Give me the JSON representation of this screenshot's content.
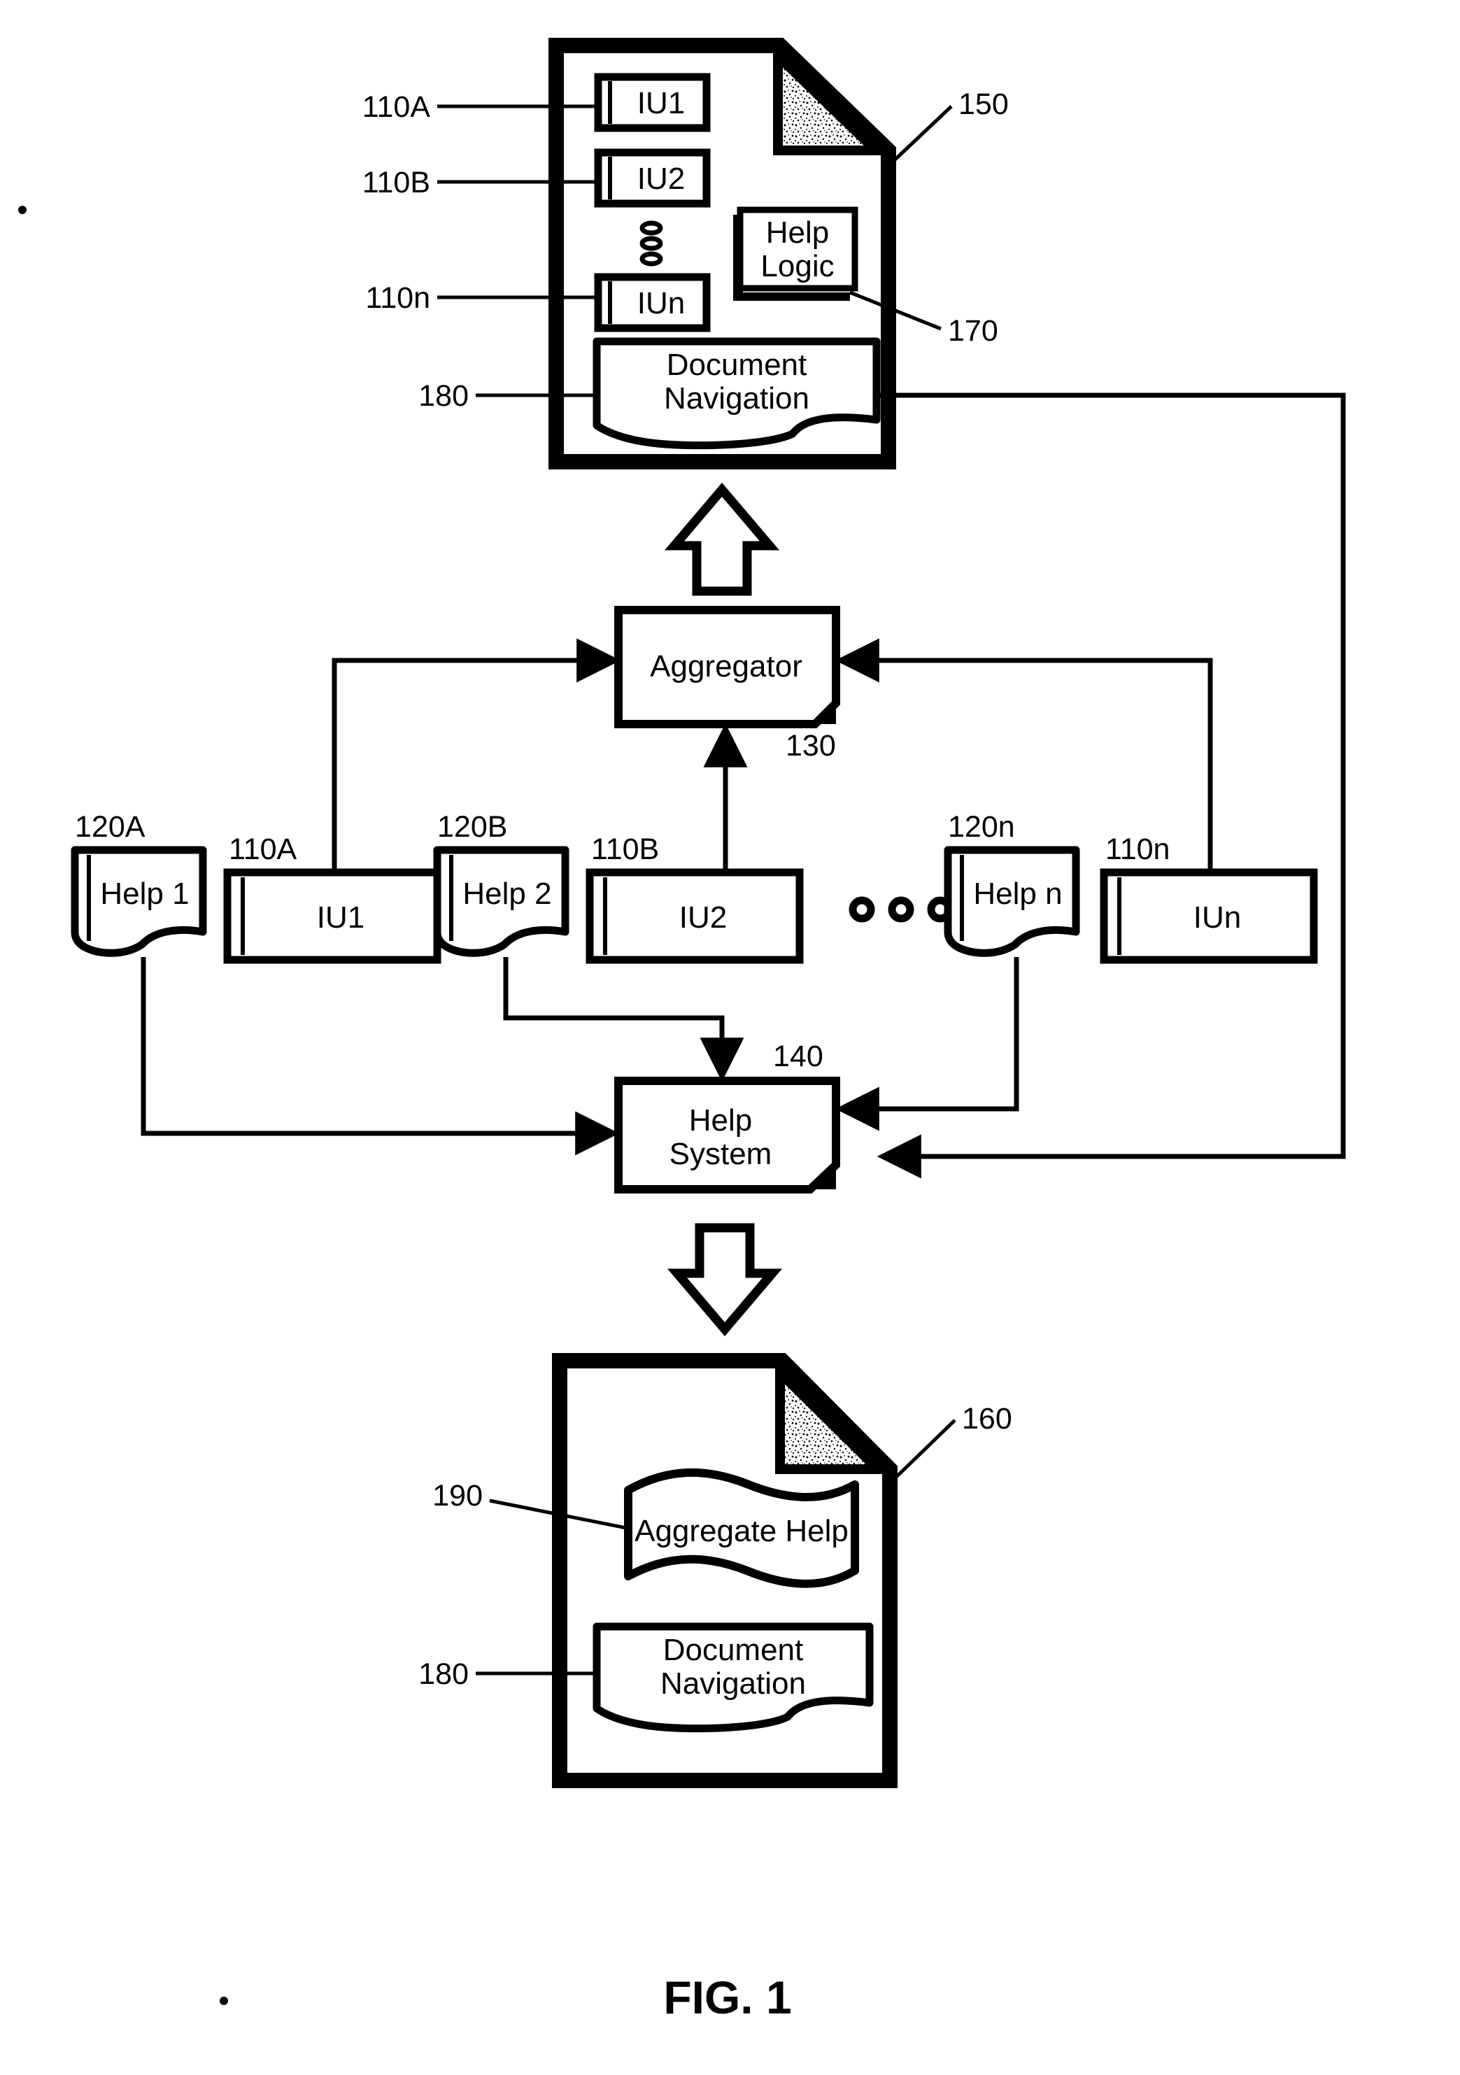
{
  "figure": {
    "caption": "FIG. 1",
    "type": "patent-block-diagram"
  },
  "top_document": {
    "ref": "150",
    "info_units": [
      {
        "ref": "110A",
        "label": "IU1"
      },
      {
        "ref": "110B",
        "label": "IU2"
      },
      {
        "ref": "110n",
        "label": "IUn"
      }
    ],
    "ellipsis": "ooo",
    "help_logic": {
      "ref": "170",
      "label_line1": "Help",
      "label_line2": "Logic"
    },
    "document_navigation": {
      "ref": "180",
      "label_line1": "Document",
      "label_line2": "Navigation"
    }
  },
  "aggregator": {
    "ref": "130",
    "label": "Aggregator"
  },
  "help_system": {
    "ref": "140",
    "label_line1": "Help",
    "label_line2": "System"
  },
  "middle_row": {
    "ellipsis": "o o o",
    "pairs": [
      {
        "help_ref": "120A",
        "help_label": "Help 1",
        "iu_ref": "110A",
        "iu_label": "IU1"
      },
      {
        "help_ref": "120B",
        "help_label": "Help 2",
        "iu_ref": "110B",
        "iu_label": "IU2"
      },
      {
        "help_ref": "120n",
        "help_label": "Help n",
        "iu_ref": "110n",
        "iu_label": "IUn"
      }
    ]
  },
  "bottom_document": {
    "ref": "160",
    "aggregate_help": {
      "ref": "190",
      "label": "Aggregate Help"
    },
    "document_navigation": {
      "ref": "180",
      "label_line1": "Document",
      "label_line2": "Navigation"
    }
  },
  "colors": {
    "ink": "#000000",
    "paper": "#ffffff"
  }
}
